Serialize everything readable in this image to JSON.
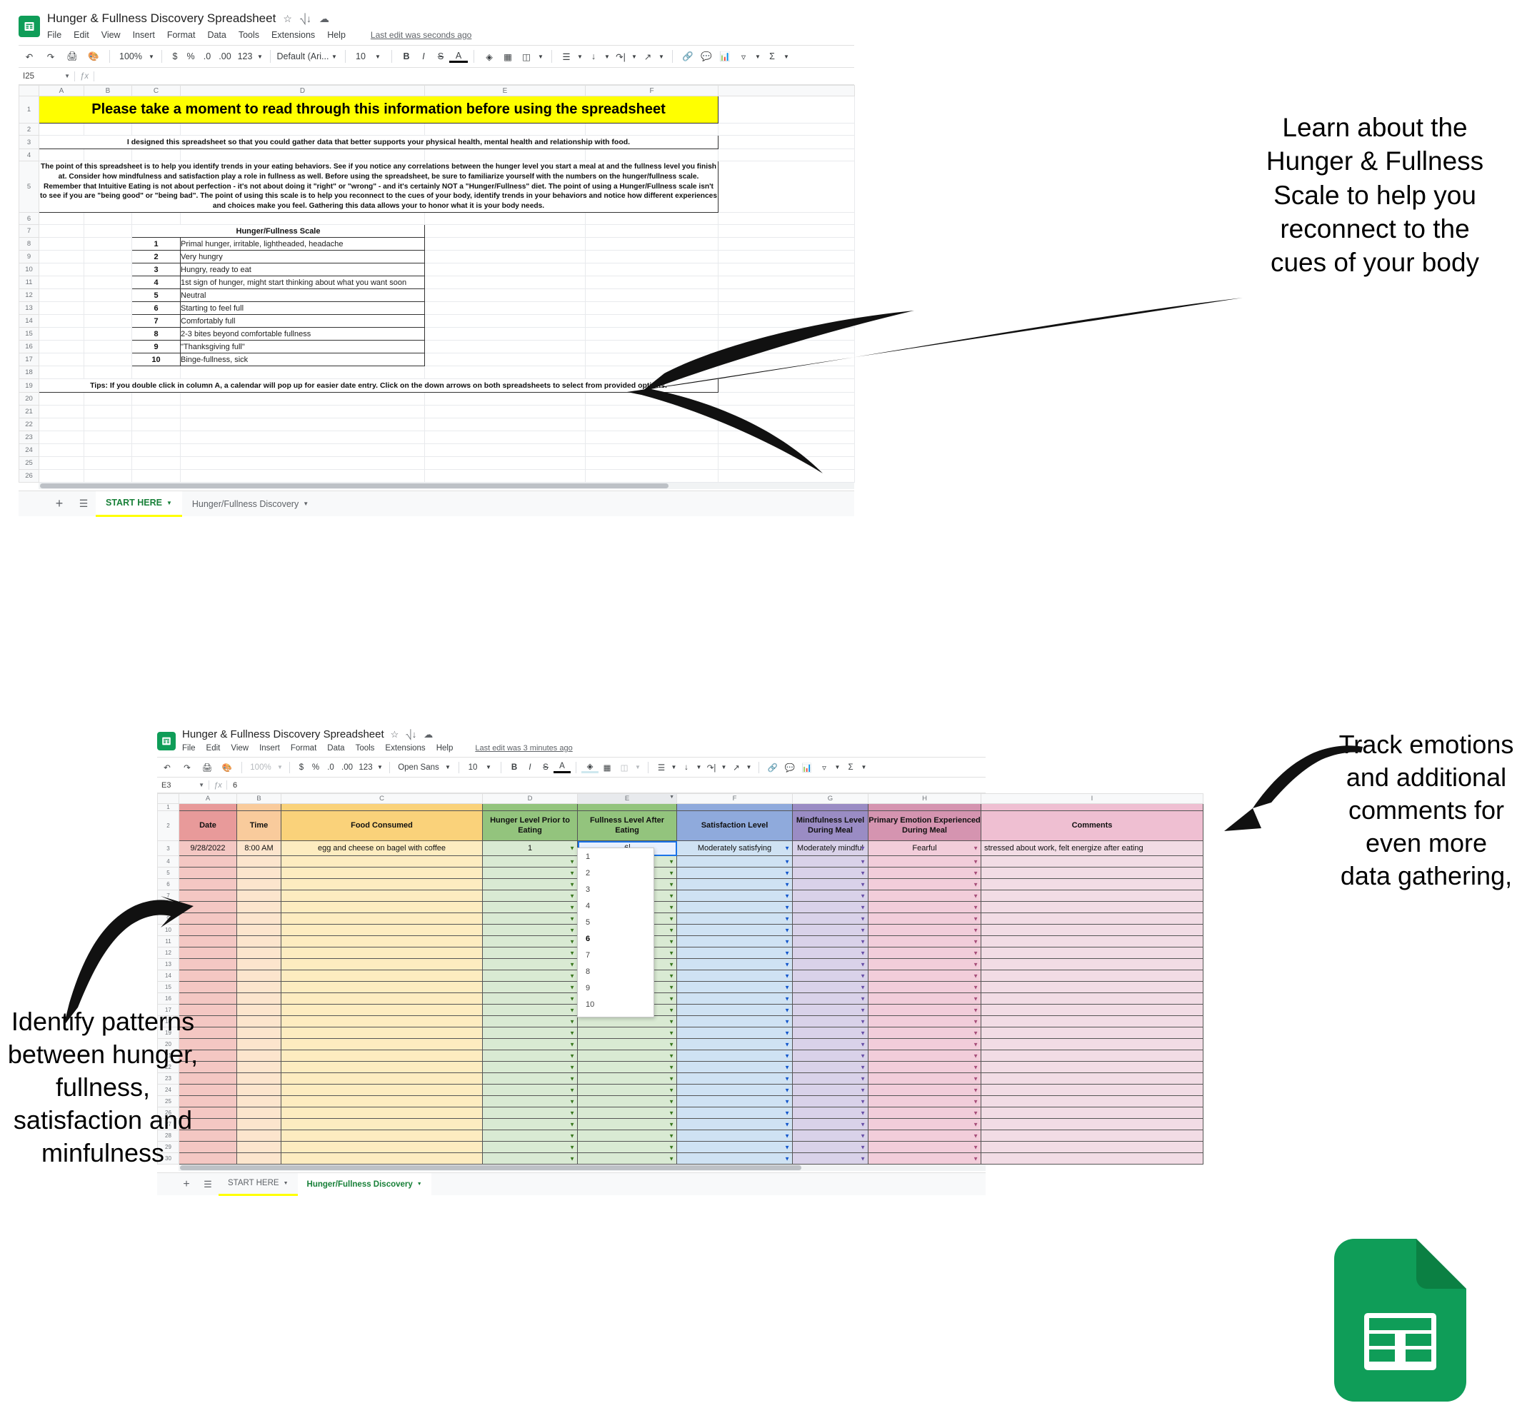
{
  "sheet1": {
    "doc_title": "Hunger & Fullness Discovery Spreadsheet",
    "title_icons": [
      "star-icon",
      "move-to-folder-icon",
      "cloud-saved-icon"
    ],
    "menus": [
      "File",
      "Edit",
      "View",
      "Insert",
      "Format",
      "Data",
      "Tools",
      "Extensions",
      "Help"
    ],
    "last_edit": "Last edit was seconds ago",
    "toolbar": {
      "undo": "undo-icon",
      "redo": "redo-icon",
      "print": "print-icon",
      "paint": "paint-format-icon",
      "zoom": "100%",
      "currency": "$",
      "percent": "%",
      "dec_less": ".0",
      "dec_more": ".00",
      "formats": "123",
      "font": "Default (Ari...",
      "font_size": "10",
      "bold": "B",
      "italic": "I",
      "strike": "S",
      "text_color": "A"
    },
    "name_box": "I25",
    "formula_value": "",
    "columns": [
      "A",
      "B",
      "C",
      "D",
      "E",
      "F"
    ],
    "rows": [
      "1",
      "2",
      "3",
      "4",
      "5",
      "6",
      "7",
      "8",
      "9",
      "10",
      "11",
      "12",
      "13",
      "14",
      "15",
      "16",
      "17",
      "18",
      "19",
      "20",
      "21",
      "22",
      "23",
      "24",
      "25",
      "26"
    ],
    "banner": "Please take a moment to read through this information before using the spreadsheet",
    "intro": "I designed this spreadsheet so that you could gather data that better supports your physical health, mental health and relationship with food.",
    "paragraph": "The point of this spreadsheet is to help you identify trends in your eating behaviors. See if you notice any correlations between the hunger level you start a meal at and the fullness level you finish at. Consider how mindfulness and satisfaction play a role in fullness as well. Before using the spreadsheet, be sure to familiarize yourself with the numbers on the hunger/fullness scale. Remember that Intuitive Eating is not about perfection - it's not about doing it \"right\" or \"wrong\" - and it's certainly NOT a \"Hunger/Fullness\" diet. The point of using a Hunger/Fullness scale isn't to see if you are \"being good\" or \"being bad\". The point of using this scale is to help you reconnect to the cues of your body, identify trends in your behaviors and notice how different experiences and choices make you feel. Gathering this data allows your to honor what it is your body needs.",
    "scale_title": "Hunger/Fullness Scale",
    "scale": [
      {
        "n": "1",
        "desc": "Primal hunger, irritable, lightheaded, headache"
      },
      {
        "n": "2",
        "desc": "Very hungry"
      },
      {
        "n": "3",
        "desc": "Hungry, ready to eat"
      },
      {
        "n": "4",
        "desc": "1st sign of hunger, might start thinking about what you want soon"
      },
      {
        "n": "5",
        "desc": "Neutral"
      },
      {
        "n": "6",
        "desc": "Starting to feel full"
      },
      {
        "n": "7",
        "desc": "Comfortably full"
      },
      {
        "n": "8",
        "desc": "2-3 bites beyond comfortable fullness"
      },
      {
        "n": "9",
        "desc": "\"Thanksgiving full\""
      },
      {
        "n": "10",
        "desc": "Binge-fullness, sick"
      }
    ],
    "tips": "Tips: If you double click in column A, a calendar will pop up for easier date entry. Click on the down arrows on both spreadsheets to select from provided options.",
    "tabs": [
      {
        "label": "START HERE",
        "active": true
      },
      {
        "label": "Hunger/Fullness Discovery",
        "active": false
      }
    ]
  },
  "sheet2": {
    "doc_title": "Hunger & Fullness Discovery Spreadsheet",
    "menus": [
      "File",
      "Edit",
      "View",
      "Insert",
      "Format",
      "Data",
      "Tools",
      "Extensions",
      "Help"
    ],
    "last_edit": "Last edit was 3 minutes ago",
    "toolbar": {
      "zoom": "100%",
      "currency": "$",
      "percent": "%",
      "dec_less": ".0",
      "dec_more": ".00",
      "formats": "123",
      "font": "Open Sans",
      "font_size": "10",
      "bold": "B",
      "italic": "I",
      "strike": "S",
      "text_color": "A"
    },
    "name_box": "E3",
    "formula_value": "6",
    "columns": [
      "A",
      "B",
      "C",
      "D",
      "E",
      "F",
      "G",
      "H",
      "I"
    ],
    "rows": [
      "1",
      "2",
      "3",
      "4",
      "5",
      "6",
      "7",
      "8",
      "9",
      "10",
      "11",
      "12",
      "13",
      "14",
      "15",
      "16",
      "17",
      "18",
      "19",
      "20",
      "21",
      "22",
      "23",
      "24",
      "25",
      "26",
      "27",
      "28",
      "29",
      "30"
    ],
    "headers": [
      "Date",
      "Time",
      "Food Consumed",
      "Hunger Level Prior to Eating",
      "Fullness Level After Eating",
      "Satisfaction Level",
      "Mindfulness Level During Meal",
      "Primary Emotion Experienced During Meal",
      "Comments"
    ],
    "header_colors": [
      "#e89a9a",
      "#f9cb9c",
      "#fad27a",
      "#93c47d",
      "#93c47d",
      "#8faadc",
      "#9a8cc4",
      "#d594b0",
      "#efbfd2"
    ],
    "row_colors": [
      "#f4c7c3",
      "#fce5cd",
      "#fdecc0",
      "#d9ead3",
      "#d9ead3",
      "#cfe2f3",
      "#d9d2e9",
      "#f2cdda",
      "#f2dce5"
    ],
    "first_row": {
      "date": "9/28/2022",
      "time": "8:00 AM",
      "food": "egg and cheese on bagel with coffee",
      "hunger": "1",
      "fullness": "6",
      "satisfaction": "Moderately satisfying",
      "mindfulness": "Moderately mindful",
      "emotion": "Fearful",
      "comments": "stressed about work, felt energize after eating"
    },
    "dropdown": {
      "options": [
        "1",
        "2",
        "3",
        "4",
        "5",
        "6",
        "7",
        "8",
        "9",
        "10"
      ],
      "selected": "6"
    },
    "tabs": [
      {
        "label": "START HERE",
        "active": false
      },
      {
        "label": "Hunger/Fullness Discovery",
        "active": true
      }
    ]
  },
  "annotations": {
    "top_right": "Learn about the Hunger & Fullness Scale to help you reconnect to the cues of your body",
    "bottom_right": "Track emotions and additional comments for even more data gathering,",
    "bottom_left": "Identify patterns between hunger, fullness, satisfaction and minfulness"
  },
  "colors": {
    "brand_green": "#0f9d58",
    "banner_yellow": "#ffff00",
    "selection_blue": "#1a73e8",
    "tab_active_green": "#188038"
  }
}
